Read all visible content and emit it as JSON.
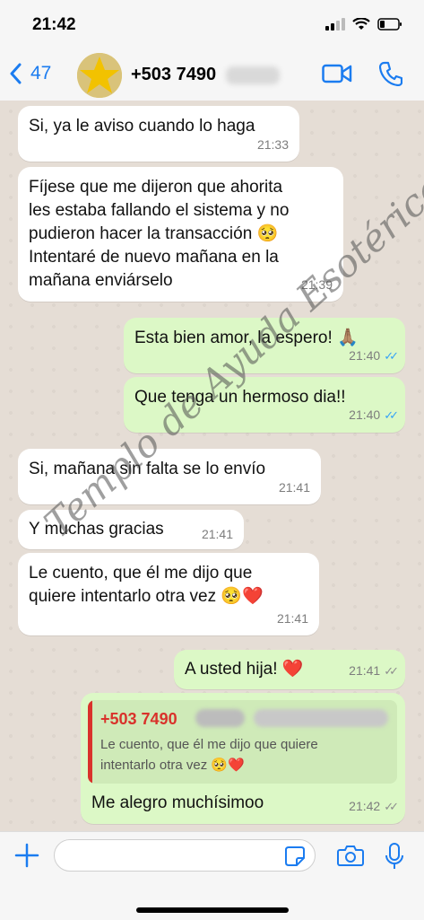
{
  "status": {
    "time": "21:42"
  },
  "header": {
    "back_count": "47",
    "contact": "+503 7490"
  },
  "messages": [
    {
      "dir": "in",
      "text": "Si, ya le aviso cuando lo haga",
      "time": "21:33"
    },
    {
      "dir": "in",
      "text": "Fíjese que me dijeron que ahorita\nles estaba fallando el sistema y no\npudieron hacer la transacción 🥺\nIntentaré de nuevo mañana en la\nmañana enviárselo",
      "time": "21:39"
    },
    {
      "dir": "out",
      "text": "Esta bien amor, la espero! 🙏🏽",
      "time": "21:40",
      "ticks": "✓✓",
      "status": "read"
    },
    {
      "dir": "out",
      "text": "Que tenga un hermoso dia!!",
      "time": "21:40",
      "ticks": "✓✓",
      "status": "read"
    },
    {
      "dir": "in",
      "text": "Si, mañana sin falta se lo envío",
      "time": "21:41"
    },
    {
      "dir": "in",
      "text": "Y muchas gracias",
      "time": "21:41"
    },
    {
      "dir": "in",
      "text": "Le cuento, que él me dijo que\nquiere intentarlo otra vez 🥺❤️",
      "time": "21:41"
    },
    {
      "dir": "out",
      "text": "A usted hija! ❤️",
      "time": "21:41",
      "ticks": "✓✓",
      "status": "sent"
    },
    {
      "dir": "out",
      "text": "Me alegro muchísimoo",
      "time": "21:42",
      "ticks": "✓✓",
      "status": "sent",
      "reply_to": {
        "name": "+503 7490",
        "text": "Le cuento, que él me dijo que quiere\nintentarlo otra vez 🥺❤️"
      }
    }
  ],
  "watermark": "Templo de Ayuda Esotérica",
  "colors": {
    "accent": "#1b7cf0",
    "out_bubble": "#dcf8c6",
    "in_bubble": "#ffffff",
    "read_tick": "#36a3f7",
    "reply_bar": "#d9322b"
  }
}
